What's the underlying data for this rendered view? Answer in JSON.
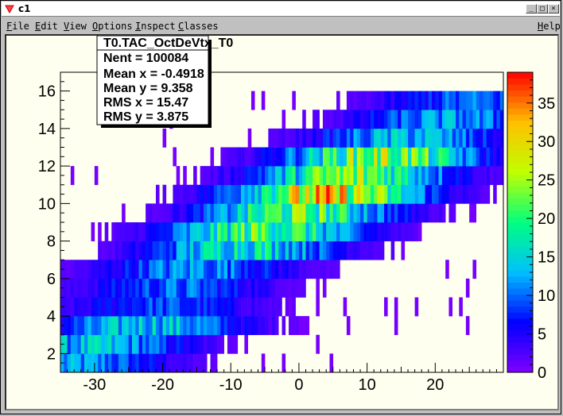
{
  "window": {
    "title": "c1"
  },
  "menu": {
    "items": [
      {
        "label": "File",
        "u": "F",
        "rest": "ile"
      },
      {
        "label": "Edit",
        "u": "E",
        "rest": "dit"
      },
      {
        "label": "View",
        "u": "V",
        "rest": "iew"
      },
      {
        "label": "Options",
        "u": "O",
        "rest": "ptions"
      },
      {
        "label": "Inspect",
        "u": "I",
        "rest": "nspect"
      },
      {
        "label": "Classes",
        "u": "C",
        "rest": "lasses"
      }
    ],
    "help": {
      "label": "Help",
      "u": "H",
      "rest": "elp"
    }
  },
  "stats": {
    "name": "T0.TAC_OctDeVtx_T0",
    "entries_label": "Nent = 100084",
    "mean_x_label": "Mean x = -0.4918",
    "mean_y_label": "Mean y = 9.358",
    "rms_x_label": "RMS x = 15.47",
    "rms_y_label": "RMS y = 3.875"
  },
  "chart_data": {
    "type": "heatmap",
    "title": "T0.TAC_OctDeVtx_T0",
    "xlabel": "",
    "ylabel": "",
    "xlim": [
      -35,
      30
    ],
    "ylim": [
      1,
      17
    ],
    "x_ticks": [
      -30,
      -20,
      -10,
      0,
      10,
      20
    ],
    "y_ticks": [
      2,
      4,
      6,
      8,
      10,
      12,
      14,
      16
    ],
    "zlim": [
      0,
      39
    ],
    "z_ticks": [
      0,
      5,
      10,
      15,
      20,
      25,
      30,
      35
    ],
    "entries": 100084,
    "mean_x": -0.4918,
    "mean_y": 9.358,
    "rms_x": 15.47,
    "rms_y": 3.875,
    "palette": "rainbow (violet low to red high)",
    "color_stops": [
      "#8000ff",
      "#0000ff",
      "#00c0ff",
      "#00ff80",
      "#c0ff00",
      "#ffc000",
      "#ff0000"
    ],
    "band_ridge": [
      {
        "y": 1.5,
        "x_peak": -33,
        "z_peak": 12
      },
      {
        "y": 2.5,
        "x_peak": -30,
        "z_peak": 14
      },
      {
        "y": 3.5,
        "x_peak": -22,
        "z_peak": 15
      },
      {
        "y": 4.5,
        "x_peak": -20,
        "z_peak": 9
      },
      {
        "y": 5.5,
        "x_peak": -18,
        "z_peak": 10
      },
      {
        "y": 6.5,
        "x_peak": -15,
        "z_peak": 12
      },
      {
        "y": 7.5,
        "x_peak": -8,
        "z_peak": 18
      },
      {
        "y": 8.5,
        "x_peak": -5,
        "z_peak": 22
      },
      {
        "y": 9.5,
        "x_peak": 0,
        "z_peak": 22
      },
      {
        "y": 10.5,
        "x_peak": 4,
        "z_peak": 30
      },
      {
        "y": 11.5,
        "x_peak": 8,
        "z_peak": 24
      },
      {
        "y": 12.5,
        "x_peak": 12,
        "z_peak": 25
      },
      {
        "y": 13.5,
        "x_peak": 16,
        "z_peak": 14
      },
      {
        "y": 14.5,
        "x_peak": 22,
        "z_peak": 12
      },
      {
        "y": 15.5,
        "x_peak": 26,
        "z_peak": 10
      }
    ]
  }
}
